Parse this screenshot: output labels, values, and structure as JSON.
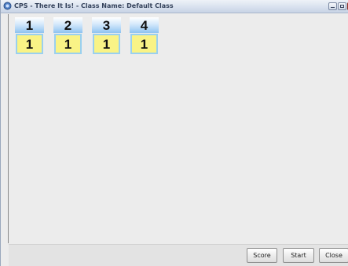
{
  "window": {
    "title": "CPS - There It Is! - Class Name: Default Class"
  },
  "tiles": [
    {
      "number": "1",
      "value": "1"
    },
    {
      "number": "2",
      "value": "1"
    },
    {
      "number": "3",
      "value": "1"
    },
    {
      "number": "4",
      "value": "1"
    }
  ],
  "footer": {
    "score_label": "Score",
    "start_label": "Start",
    "close_label": "Close"
  },
  "colors": {
    "tile_header": "#8fc3f1",
    "tile_value_bg": "#f9f386",
    "background": "#ececec"
  }
}
